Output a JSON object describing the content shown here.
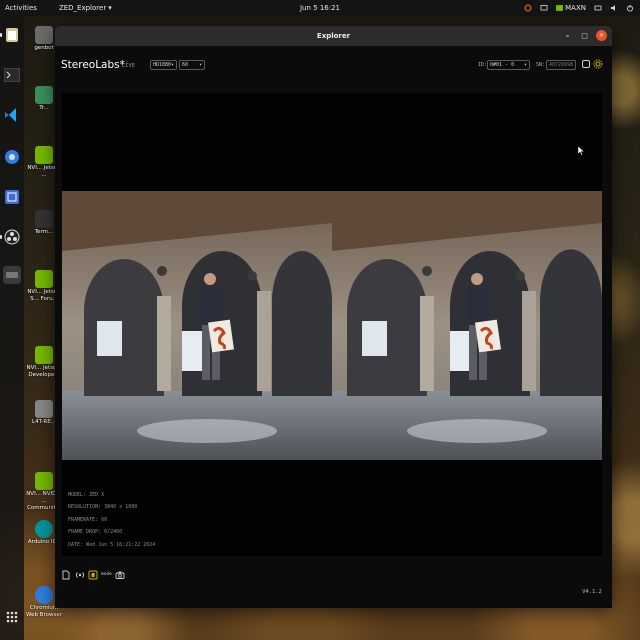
{
  "topbar": {
    "activities": "Activities",
    "app_name": "ZED_Explorer",
    "app_menu_caret": "▾",
    "clock": "Jun 5  16:21",
    "power_mode": "MAXN"
  },
  "desktop_icons": [
    {
      "label": "genbot"
    },
    {
      "label": "Tr..."
    },
    {
      "label": "NVI... Jetson ..."
    },
    {
      "label": "Term..."
    },
    {
      "label": "NVI... Jetson S... Foru..."
    },
    {
      "label": "NVI... Jetso... Develope..."
    },
    {
      "label": "L4T-RE..."
    },
    {
      "label": "NVI... NVIDIA ... Communit..."
    },
    {
      "label": "Arduino IDE"
    },
    {
      "label": "Chromium Web Browser"
    }
  ],
  "window": {
    "title": "Explorer",
    "minimize": "–",
    "maximize": "□",
    "close": "✕"
  },
  "toolbar": {
    "logo": "StereoLabs*",
    "mode": "LIVE",
    "resolution": "HD1080",
    "fps": "60",
    "id_label": "ID:",
    "id_value": "0#01 - 0",
    "sn_label": "SN:",
    "sn_value": "40729998"
  },
  "metadata": {
    "model": "MODEL: ZED X",
    "resolution": "RESOLUTION: 3840 x 1080",
    "framerate": "FRAMERATE: 60",
    "frame_drop": "FRAME DROP: 0/2460",
    "date": "DATE: Wed Jun 5 16:21:22 2024"
  },
  "bottombar": {
    "mode_label": "mode",
    "version": "V4.1.2"
  },
  "colors": {
    "accent": "#e95420",
    "nvidia": "#76b900",
    "window_bg": "#0b0b0b"
  }
}
